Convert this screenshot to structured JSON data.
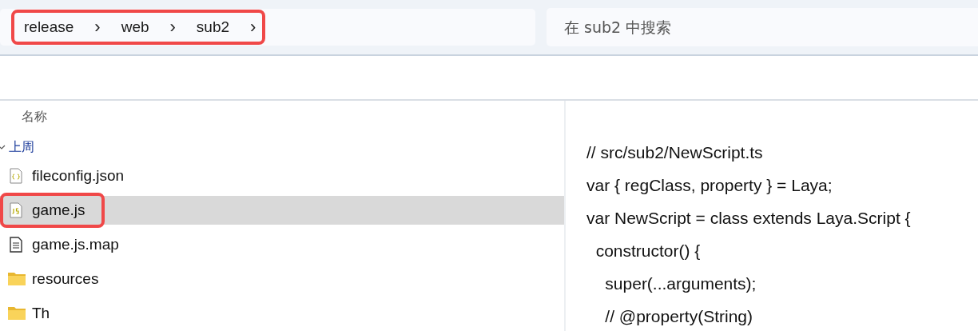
{
  "address_bar": {
    "highlighted": true,
    "segments": [
      "release",
      "web",
      "sub2"
    ],
    "separator": "›"
  },
  "search": {
    "placeholder": "在 sub2 中搜索"
  },
  "file_list": {
    "column_header": "名称",
    "group": {
      "label": "上周",
      "expanded": true
    },
    "items": [
      {
        "name": "fileconfig.json",
        "kind": "json",
        "selected": false,
        "highlighted": false
      },
      {
        "name": "game.js",
        "kind": "js",
        "selected": true,
        "highlighted": true
      },
      {
        "name": "game.js.map",
        "kind": "text",
        "selected": false,
        "highlighted": false
      },
      {
        "name": "resources",
        "kind": "folder",
        "selected": false,
        "highlighted": false
      },
      {
        "name": "Th",
        "kind": "folder",
        "selected": false,
        "highlighted": false
      }
    ]
  },
  "preview": {
    "lines": [
      "// src/sub2/NewScript.ts",
      "var { regClass, property } = Laya;",
      "var NewScript = class extends Laya.Script {",
      "  constructor() {",
      "    super(...arguments);",
      "    // @property(String)"
    ]
  }
}
